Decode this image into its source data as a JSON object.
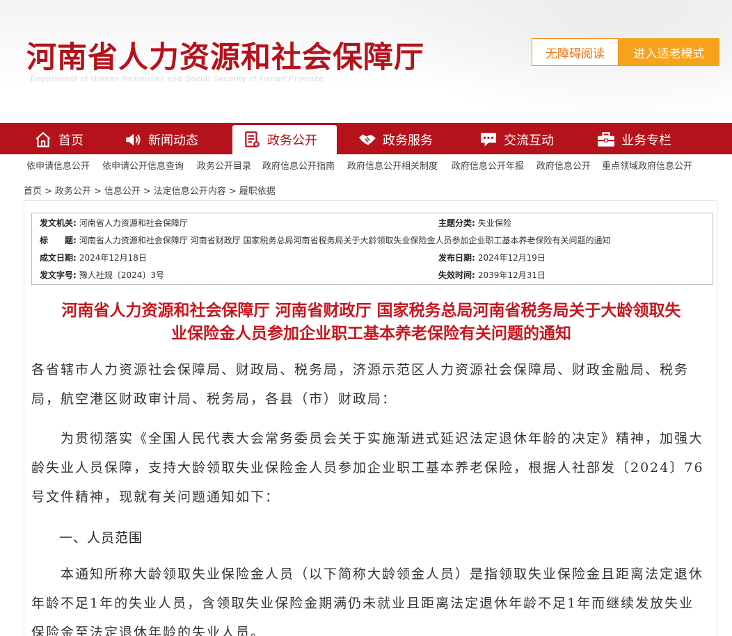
{
  "header": {
    "site_title": "河南省人力资源和社会保障厅",
    "site_subtitle": "Department of Human Resources and Social Security of Henan Province",
    "accessible_read": "无障碍阅读",
    "elder_mode": "进入适老模式"
  },
  "nav": {
    "items": [
      {
        "label": "首页",
        "icon": "home-icon"
      },
      {
        "label": "新闻动态",
        "icon": "speaker-icon"
      },
      {
        "label": "政务公开",
        "icon": "document-icon"
      },
      {
        "label": "政务服务",
        "icon": "handshake-icon"
      },
      {
        "label": "交流互动",
        "icon": "chat-icon"
      },
      {
        "label": "业务专栏",
        "icon": "briefcase-icon"
      }
    ],
    "active": "政务公开"
  },
  "subnav": {
    "items": [
      "依申请信息公开",
      "依申请公开信息查询",
      "政务公开目录",
      "政府信息公开指南",
      "政府信息公开相关制度",
      "政府信息公开年报",
      "政府信息公开",
      "重点领域政府信息公开"
    ]
  },
  "breadcrumb": [
    "首页",
    "政务公开",
    "信息公开",
    "法定信息公开内容",
    "履职依据"
  ],
  "breadcrumb_separator": ">",
  "meta": {
    "issuer_label": "发文机关:",
    "issuer": "河南省人力资源和社会保障厅",
    "topic_label": "主题分类:",
    "topic": "失业保险",
    "title_label": "标　　题:",
    "title": "河南省人力资源和社会保障厅 河南省财政厅 国家税务总局河南省税务局关于大龄领取失业保险金人员参加企业职工基本养老保险有关问题的通知",
    "created_label": "成文日期:",
    "created": "2024年12月18日",
    "published_label": "发布日期:",
    "published": "2024年12月19日",
    "docno_label": "发文字号:",
    "docno": "豫人社规〔2024〕3号",
    "expires_label": "失效时间:",
    "expires": "2039年12月31日"
  },
  "document": {
    "title_line1": "河南省人力资源和社会保障厅 河南省财政厅 国家税务总局河南省税务局关于大龄领取失",
    "title_line2": "业保险金人员参加企业职工基本养老保险有关问题的通知",
    "addressee": "各省辖市人力资源社会保障局、财政局、税务局，济源示范区人力资源社会保障局、财政金融局、税务局，航空港区财政审计局、税务局，各县（市）财政局：",
    "intro": "为贯彻落实《全国人民代表大会常务委员会关于实施渐进式延迟法定退休年龄的决定》精神，加强大龄失业人员保障，支持大龄领取失业保险金人员参加企业职工基本养老保险，根据人社部发〔2024〕76号文件精神，现就有关问题通知如下：",
    "section1_heading": "一、人员范围",
    "section1_body": "本通知所称大龄领取失业保险金人员（以下简称大龄领金人员）是指领取失业保险金且距离法定退休年龄不足1年的失业人员，含领取失业保险金期满仍未就业且距离法定退休年龄不足1年而继续发放失业保险金至法定退休年龄的失业人员。"
  },
  "colors": {
    "brand_red": "#b5121b",
    "title_red": "#c8161d",
    "orange": "#f6a21a"
  }
}
